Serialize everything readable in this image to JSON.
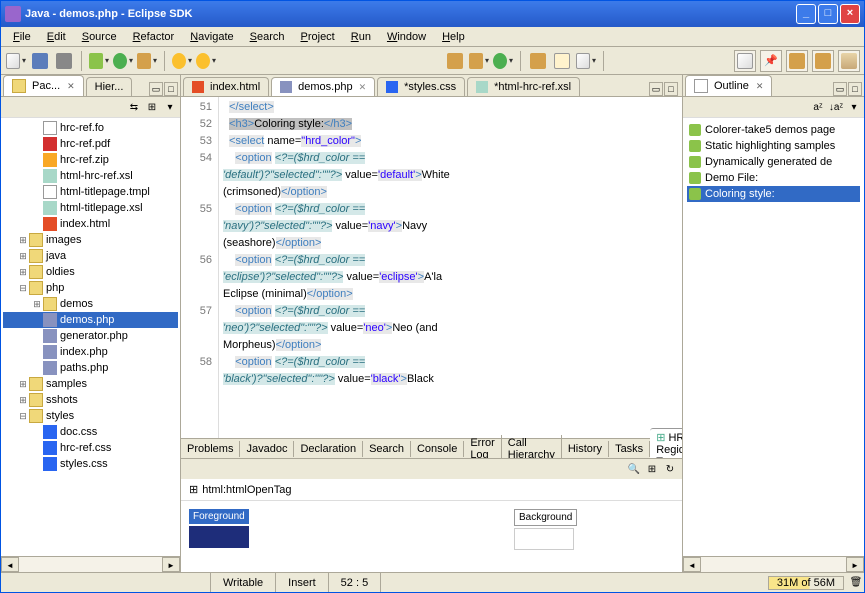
{
  "window": {
    "title": "Java - demos.php - Eclipse SDK"
  },
  "menu": [
    "File",
    "Edit",
    "Source",
    "Refactor",
    "Navigate",
    "Search",
    "Project",
    "Run",
    "Window",
    "Help"
  ],
  "leftTabs": {
    "active": "Pac...",
    "other": "Hier..."
  },
  "projectTree": {
    "items": [
      {
        "indent": 2,
        "icon": "fi-file",
        "label": "hrc-ref.fo"
      },
      {
        "indent": 2,
        "icon": "fi-pdf",
        "label": "hrc-ref.pdf"
      },
      {
        "indent": 2,
        "icon": "fi-zip",
        "label": "hrc-ref.zip"
      },
      {
        "indent": 2,
        "icon": "fi-xsl",
        "label": "html-hrc-ref.xsl"
      },
      {
        "indent": 2,
        "icon": "fi-file",
        "label": "html-titlepage.tmpl"
      },
      {
        "indent": 2,
        "icon": "fi-xsl",
        "label": "html-titlepage.xsl"
      },
      {
        "indent": 2,
        "icon": "fi-html",
        "label": "index.html"
      },
      {
        "indent": 1,
        "toggle": "⊞",
        "icon": "fi-folder",
        "label": "images"
      },
      {
        "indent": 1,
        "toggle": "⊞",
        "icon": "fi-folder",
        "label": "java"
      },
      {
        "indent": 1,
        "toggle": "⊞",
        "icon": "fi-folder",
        "label": "oldies"
      },
      {
        "indent": 1,
        "toggle": "⊟",
        "icon": "fi-folder",
        "label": "php"
      },
      {
        "indent": 2,
        "toggle": "⊞",
        "icon": "fi-folder",
        "label": "demos"
      },
      {
        "indent": 2,
        "icon": "fi-php",
        "label": "demos.php",
        "selected": true
      },
      {
        "indent": 2,
        "icon": "fi-php",
        "label": "generator.php"
      },
      {
        "indent": 2,
        "icon": "fi-php",
        "label": "index.php"
      },
      {
        "indent": 2,
        "icon": "fi-php",
        "label": "paths.php"
      },
      {
        "indent": 1,
        "toggle": "⊞",
        "icon": "fi-folder",
        "label": "samples"
      },
      {
        "indent": 1,
        "toggle": "⊞",
        "icon": "fi-folder",
        "label": "sshots"
      },
      {
        "indent": 1,
        "toggle": "⊟",
        "icon": "fi-folder",
        "label": "styles"
      },
      {
        "indent": 2,
        "icon": "fi-css",
        "label": "doc.css"
      },
      {
        "indent": 2,
        "icon": "fi-css",
        "label": "hrc-ref.css"
      },
      {
        "indent": 2,
        "icon": "fi-css",
        "label": "styles.css"
      }
    ]
  },
  "editorTabs": [
    {
      "label": "index.html",
      "icon": "fi-html"
    },
    {
      "label": "demos.php",
      "icon": "fi-php",
      "active": true
    },
    {
      "label": "*styles.css",
      "icon": "fi-css"
    },
    {
      "label": "*html-hrc-ref.xsl",
      "icon": "fi-xsl"
    }
  ],
  "code": {
    "startLine": 51,
    "lines": [
      {
        "n": 51,
        "html": "  <span class='hl-tag'>&lt;/select&gt;</span>"
      },
      {
        "n": 52,
        "html": "  <span class='hl-h3 hl-tag'>&lt;h3&gt;</span><span class='hl-h3'>Coloring style:</span><span class='hl-h3 hl-tag'>&lt;/h3&gt;</span>"
      },
      {
        "n": 53,
        "html": "  <span class='hl-tag'>&lt;select</span> name=<span class='hl-str'>\"hrd_color\"</span><span class='hl-tag'>&gt;</span>"
      },
      {
        "n": 54,
        "html": "    <span class='hl-tag'>&lt;option</span> <span class='hl-expr'>&lt;?=($hrd_color ==</span>"
      },
      {
        "n": "",
        "html": "<span class='hl-expr'>'default')?\"selected\":\"\"?&gt;</span> value=<span class='hl-str'>'default'</span><span class='hl-tag'>&gt;</span>White"
      },
      {
        "n": "",
        "html": "(crimsoned)<span class='hl-tag'>&lt;/option&gt;</span>"
      },
      {
        "n": 55,
        "html": "    <span class='hl-tag'>&lt;option</span> <span class='hl-expr'>&lt;?=($hrd_color ==</span>"
      },
      {
        "n": "",
        "html": "<span class='hl-expr'>'navy')?\"selected\":\"\"?&gt;</span> value=<span class='hl-str'>'navy'</span><span class='hl-tag'>&gt;</span>Navy"
      },
      {
        "n": "",
        "html": "(seashore)<span class='hl-tag'>&lt;/option&gt;</span>"
      },
      {
        "n": 56,
        "html": "    <span class='hl-tag'>&lt;option</span> <span class='hl-expr'>&lt;?=($hrd_color ==</span>"
      },
      {
        "n": "",
        "html": "<span class='hl-expr'>'eclipse')?\"selected\":\"\"?&gt;</span> value=<span class='hl-str'>'eclipse'</span><span class='hl-tag'>&gt;</span>A'la"
      },
      {
        "n": "",
        "html": "Eclipse (minimal)<span class='hl-tag'>&lt;/option&gt;</span>"
      },
      {
        "n": 57,
        "html": "    <span class='hl-tag'>&lt;option</span> <span class='hl-expr'>&lt;?=($hrd_color ==</span>"
      },
      {
        "n": "",
        "html": "<span class='hl-expr'>'neo')?\"selected\":\"\"?&gt;</span> value=<span class='hl-str'>'neo'</span><span class='hl-tag'>&gt;</span>Neo (and"
      },
      {
        "n": "",
        "html": "Morpheus)<span class='hl-tag'>&lt;/option&gt;</span>"
      },
      {
        "n": 58,
        "html": "    <span class='hl-tag'>&lt;option</span> <span class='hl-expr'>&lt;?=($hrd_color ==</span>"
      },
      {
        "n": "",
        "html": "<span class='hl-expr'>'black')?\"selected\":\"\"?&gt;</span> value=<span class='hl-str'>'black'</span><span class='hl-tag'>&gt;</span>Black"
      }
    ]
  },
  "outline": {
    "title": "Outline",
    "items": [
      {
        "label": "Colorer-take5 demos page"
      },
      {
        "label": "Static highlighting samples"
      },
      {
        "label": "Dynamically generated de"
      },
      {
        "label": "Demo File:"
      },
      {
        "label": "Coloring style:",
        "selected": true
      }
    ]
  },
  "bottomTabs": [
    "Problems",
    "Javadoc",
    "Declaration",
    "Search",
    "Console",
    "Error Log",
    "Call Hierarchy",
    "History",
    "Tasks"
  ],
  "bottomActive": "HRC Regions Tree",
  "regionTree": {
    "node": "html:htmlOpenTag",
    "fg": "Foreground",
    "bg": "Background"
  },
  "status": {
    "writable": "Writable",
    "mode": "Insert",
    "pos": "52 : 5",
    "mem": "31M of 56M"
  }
}
